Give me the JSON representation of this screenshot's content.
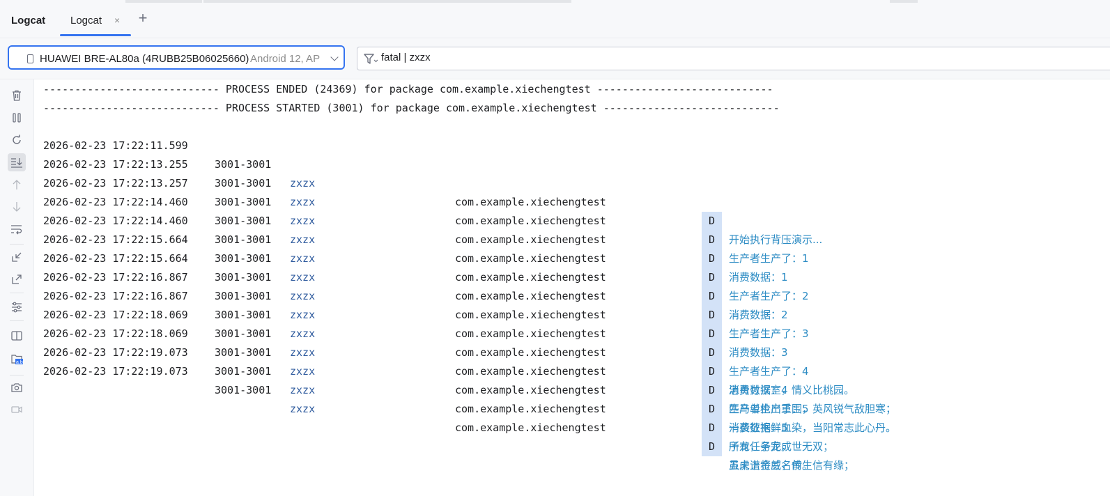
{
  "tool_window": {
    "title": "Logcat"
  },
  "tabs": [
    {
      "label": "Logcat",
      "close": "×"
    }
  ],
  "add_tab": "+",
  "device": {
    "name": "HUAWEI BRE-AL80a (4RUBB25B06025660)",
    "os": "Android 12, AP"
  },
  "filter": {
    "query": "fatal | zxzx"
  },
  "sidebar_icons": [
    "trash-icon",
    "pause-icon",
    "restart-icon",
    "scroll-to-end-icon",
    "up-arrow-icon",
    "down-arrow-icon",
    "soft-wrap-icon",
    "collapse-icon",
    "expand-icon",
    "settings-sliders-icon",
    "split-panels-icon",
    "view-format-icon",
    "camera-icon",
    "video-icon"
  ],
  "colors": {
    "accent": "#3574f0",
    "tag": "#2f5b9e",
    "message": "#2d8cc4",
    "level_bg": "#d3e2f7"
  },
  "log": {
    "banners": [
      "---------------------------- PROCESS ENDED (24369) for package com.example.xiechengtest ----------------------------",
      "---------------------------- PROCESS STARTED (3001) for package com.example.xiechengtest ----------------------------"
    ],
    "entries": [
      {
        "time": "2026-02-23 17:22:11.599",
        "pid": "3001-3001",
        "tag": "zxzx",
        "package": "com.example.xiechengtest",
        "level": "D",
        "message": "开始执行背压演示..."
      },
      {
        "time": "2026-02-23 17:22:13.255",
        "pid": "3001-3001",
        "tag": "zxzx",
        "package": "com.example.xiechengtest",
        "level": "D",
        "message": "生产者生产了：1"
      },
      {
        "time": "2026-02-23 17:22:13.257",
        "pid": "3001-3001",
        "tag": "zxzx",
        "package": "com.example.xiechengtest",
        "level": "D",
        "message": "消费数据：1"
      },
      {
        "time": "2026-02-23 17:22:14.460",
        "pid": "3001-3001",
        "tag": "zxzx",
        "package": "com.example.xiechengtest",
        "level": "D",
        "message": "生产者生产了：2"
      },
      {
        "time": "2026-02-23 17:22:14.460",
        "pid": "3001-3001",
        "tag": "zxzx",
        "package": "com.example.xiechengtest",
        "level": "D",
        "message": "消费数据：2"
      },
      {
        "time": "2026-02-23 17:22:15.664",
        "pid": "3001-3001",
        "tag": "zxzx",
        "package": "com.example.xiechengtest",
        "level": "D",
        "message": "生产者生产了：3"
      },
      {
        "time": "2026-02-23 17:22:15.664",
        "pid": "3001-3001",
        "tag": "zxzx",
        "package": "com.example.xiechengtest",
        "level": "D",
        "message": "消费数据：3"
      },
      {
        "time": "2026-02-23 17:22:16.867",
        "pid": "3001-3001",
        "tag": "zxzx",
        "package": "com.example.xiechengtest",
        "level": "D",
        "message": "生产者生产了：4"
      },
      {
        "time": "2026-02-23 17:22:16.867",
        "pid": "3001-3001",
        "tag": "zxzx",
        "package": "com.example.xiechengtest",
        "level": "D",
        "message": "消费数据：4"
      },
      {
        "time": "2026-02-23 17:22:18.069",
        "pid": "3001-3001",
        "tag": "zxzx",
        "package": "com.example.xiechengtest",
        "level": "D",
        "message": "生产者生产了：5"
      },
      {
        "time": "2026-02-23 17:22:18.069",
        "pid": "3001-3001",
        "tag": "zxzx",
        "package": "com.example.xiechengtest",
        "level": "D",
        "message": "消费数据：5"
      },
      {
        "time": "2026-02-23 17:22:19.073",
        "pid": "3001-3001",
        "tag": "zxzx",
        "package": "com.example.xiechengtest",
        "level": "D",
        "message": "所有任务完成"
      },
      {
        "time": "2026-02-23 17:22:19.073",
        "pid": "3001-3001",
        "tag": "zxzx",
        "package": "com.example.xiechengtest",
        "level": "D",
        "message": "虽未谱金兰，前生信有缘；"
      }
    ],
    "continuation": [
      "忠勇付汉室，情义比桃园。",
      "匹马单枪出重围，英风锐气敌胆寒；",
      "一袭征袍鲜血染，当阳常志此心丹。",
      "子龙，子龙，世无双；",
      "五虎上将威名传。"
    ]
  }
}
